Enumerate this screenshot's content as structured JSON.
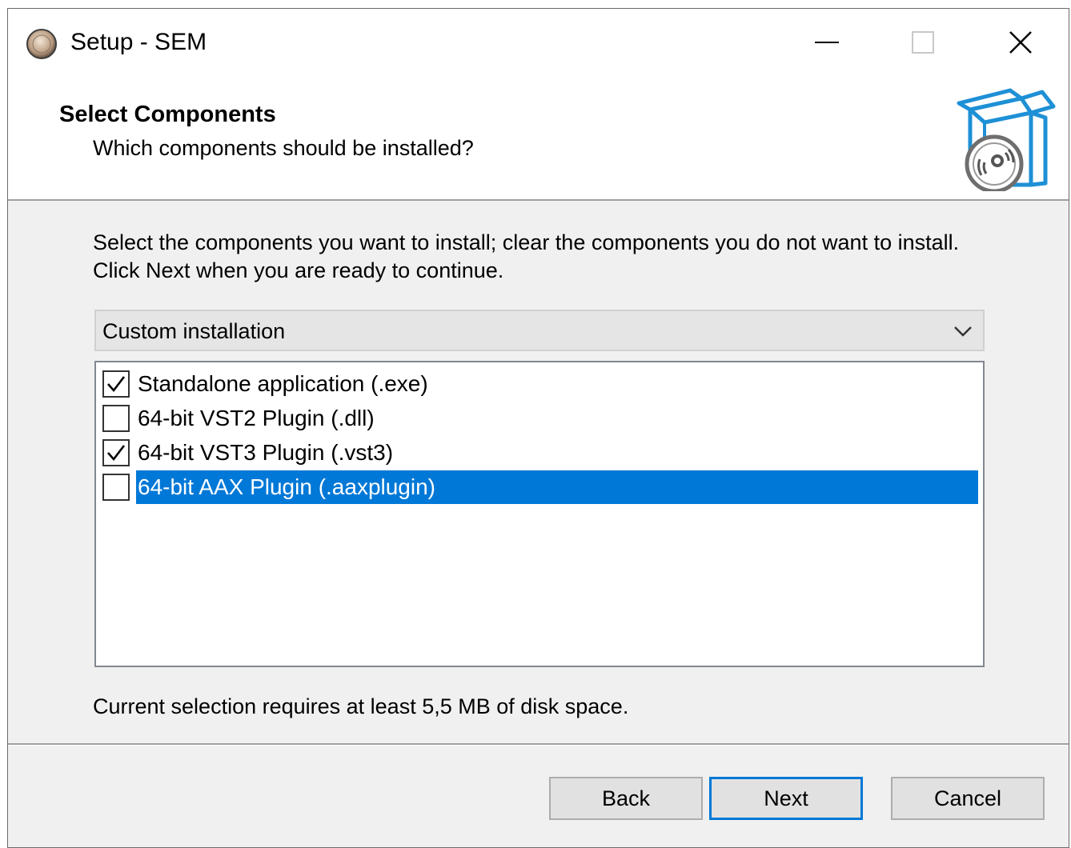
{
  "window": {
    "title": "Setup - SEM",
    "app_icon": "sem-disc-icon",
    "controls": {
      "minimize_icon": "minimize-icon",
      "maximize_icon": "maximize-icon",
      "close_icon": "close-icon"
    }
  },
  "header": {
    "title": "Select Components",
    "subtitle": "Which components should be installed?",
    "icon": "box-disc-icon"
  },
  "body": {
    "instructions": "Select the components you want to install; clear the components you do not want to install. Click Next when you are ready to continue.",
    "install_type": {
      "selected": "Custom installation",
      "arrow_icon": "chevron-down-icon"
    },
    "components": [
      {
        "label": "Standalone application (.exe)",
        "checked": true,
        "selected": false
      },
      {
        "label": "64-bit VST2 Plugin (.dll)",
        "checked": false,
        "selected": false
      },
      {
        "label": "64-bit VST3 Plugin (.vst3)",
        "checked": true,
        "selected": false
      },
      {
        "label": "64-bit AAX Plugin (.aaxplugin)",
        "checked": false,
        "selected": true
      }
    ],
    "disk_space": "Current selection requires at least 5,5 MB of disk space."
  },
  "buttons": {
    "back": "Back",
    "next": "Next",
    "cancel": "Cancel"
  },
  "colors": {
    "selection": "#0078d7",
    "window_bg": "#f0f0f0",
    "header_icon": "#1e90d6"
  }
}
